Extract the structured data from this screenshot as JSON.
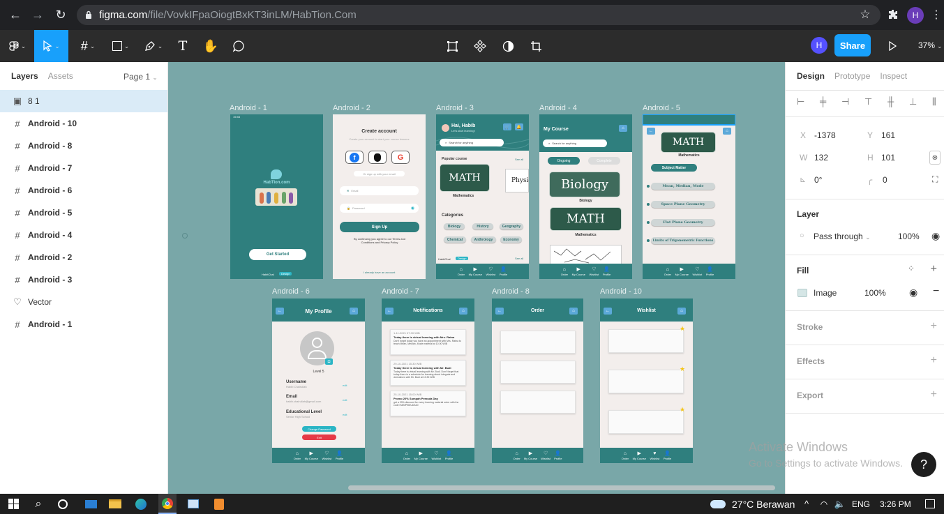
{
  "browser": {
    "url_domain": "figma.com",
    "url_path": "/file/VovkIFpaOiogtBxKT3inLM/HabTion.Com",
    "profile_initial": "H"
  },
  "toolbar": {
    "share_label": "Share",
    "zoom": "37%",
    "avatar_initial": "H"
  },
  "layers_panel": {
    "tab_layers": "Layers",
    "tab_assets": "Assets",
    "page": "Page 1",
    "items": [
      {
        "icon": "image",
        "label": "8 1",
        "selected": true
      },
      {
        "icon": "frame",
        "label": "Android - 10"
      },
      {
        "icon": "frame",
        "label": "Android - 8"
      },
      {
        "icon": "frame",
        "label": "Android - 7"
      },
      {
        "icon": "frame",
        "label": "Android - 6"
      },
      {
        "icon": "frame",
        "label": "Android - 5"
      },
      {
        "icon": "frame",
        "label": "Android - 4"
      },
      {
        "icon": "frame",
        "label": "Android - 2"
      },
      {
        "icon": "frame",
        "label": "Android - 3"
      },
      {
        "icon": "vector",
        "label": "Vector"
      },
      {
        "icon": "frame",
        "label": "Android - 1"
      }
    ]
  },
  "canvas": {
    "frame_labels": {
      "a1": "Android - 1",
      "a2": "Android - 2",
      "a3": "Android - 3",
      "a4": "Android - 4",
      "a5": "Android - 5",
      "a6": "Android - 6",
      "a7": "Android - 7",
      "a8": "Android - 8",
      "a10": "Android - 10"
    },
    "a1": {
      "time": "19:45",
      "logo": "HabTion.com",
      "button": "Get Started",
      "footer": "HabitChal",
      "badge": "Design"
    },
    "a2": {
      "title": "Create account",
      "subtitle": "Create your account to start your course lessons",
      "or": "Or sign up with your email",
      "email": "Email",
      "password": "Password",
      "signup": "Sign Up",
      "terms": "By continuing you agree to our Terms and Conditions and Privacy Policy",
      "login": "I already have an account"
    },
    "a3": {
      "greeting": "Hai, Habib",
      "sub": "Let's start learning!",
      "search": "Search for anything",
      "popular": "Popular course",
      "see_all": "See all",
      "board": "MATH",
      "course": "Mathematics",
      "physic": "Physic",
      "categories": "Categories",
      "cats": [
        "Biology",
        "History",
        "Geography",
        "Chemical",
        "Anthrology",
        "Economy"
      ],
      "footer": "HabitChal",
      "badge": "Design"
    },
    "a4": {
      "title": "My Course",
      "search": "Search for anything",
      "tab1": "Ongoing",
      "tab2": "Complete",
      "board1": "Biology",
      "cap1": "Biology",
      "board2": "MATH",
      "cap2": "Mathematics"
    },
    "a5": {
      "board": "MATH",
      "course": "Mathematics",
      "subject": "Subject Matter",
      "topics": [
        "Mean, Median, Mode",
        "Space Plane Geometry",
        "Flat Plane Geometry",
        "Limits of Trigonometric Functions"
      ]
    },
    "a6": {
      "title": "My Profile",
      "level": "Level 5",
      "fields": [
        {
          "label": "Username",
          "value": "Habib Chairullah",
          "edit": "edit"
        },
        {
          "label": "Email",
          "value": "habib.chairullah@gmail.com",
          "edit": "edit"
        },
        {
          "label": "Educational Level",
          "value": "Senior High School",
          "edit": "edit"
        }
      ],
      "change_pw": "Change Password",
      "exit": "Exit"
    },
    "a7": {
      "title": "Notifications",
      "items": [
        {
          "date": "1-11-2021  07.00 WIB",
          "head": "Today there is virtual learning with Mrs. Ratna",
          "body": "Don't forget today you have an appointment with Mrs. Ratna to teach Mean, Median, Mode material at 10.00 WIB"
        },
        {
          "date": "29-10-2021  15.30 WIB",
          "head": "Today there is virtual learning with Mr. Budi",
          "body": "Today there is virtual learning with Mr. Budi. Don't forget that today there is a schedule for learning about integrals and derivatives with Mr. Budi at 13.30 WIB"
        },
        {
          "date": "25-10-2021  15.00 WIB",
          "head": "Promo 20% Sumpah Pemuda Day",
          "body": "get a 20% discount for every learning material order with the code HABIPEMUDA20"
        }
      ]
    },
    "a8": {
      "title": "Order"
    },
    "a10": {
      "title": "Wishlist"
    },
    "nav": [
      "Order",
      "My Course",
      "Wishlist",
      "Profile"
    ]
  },
  "design_panel": {
    "tab_design": "Design",
    "tab_prototype": "Prototype",
    "tab_inspect": "Inspect",
    "x_label": "X",
    "x": "-1378",
    "y_label": "Y",
    "y": "161",
    "w_label": "W",
    "w": "132",
    "h_label": "H",
    "h": "101",
    "rotation": "0°",
    "radius": "0",
    "layer_title": "Layer",
    "blend": "Pass through",
    "opacity": "100%",
    "fill_title": "Fill",
    "fill_type": "Image",
    "fill_opacity": "100%",
    "stroke": "Stroke",
    "effects": "Effects",
    "export": "Export"
  },
  "watermark": {
    "line1": "Activate Windows",
    "line2": "Go to Settings to activate Windows."
  },
  "taskbar": {
    "weather": "27°C  Berawan",
    "lang": "ENG",
    "time": "3:26 PM"
  },
  "colors": {
    "accent": "#18a0fb",
    "canvas": "#79a7a8",
    "app_teal": "#2f7f7e",
    "selection": "#daebf7"
  }
}
